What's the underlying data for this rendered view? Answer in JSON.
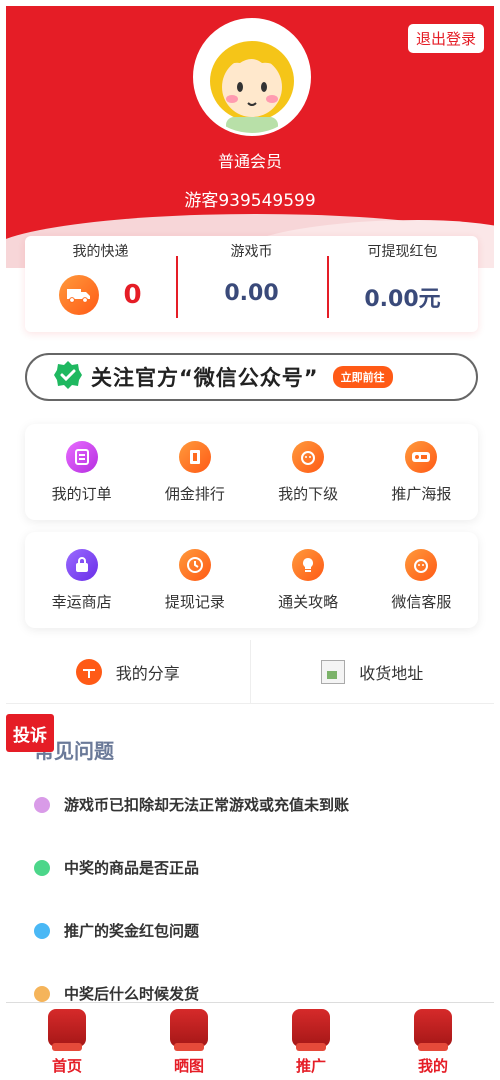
{
  "header": {
    "logout_label": "退出登录",
    "member_level": "普通会员",
    "username": "游客939549599",
    "brand_color": "#e51d26"
  },
  "stats": [
    {
      "label": "我的快递",
      "value": "0",
      "icon": "truck-icon"
    },
    {
      "label": "游戏币",
      "value": "0.00"
    },
    {
      "label": "可提现红包",
      "value": "0.00元"
    }
  ],
  "banner": {
    "text": "关注官方“微信公众号”",
    "button_label": "立即前往",
    "icon": "check-badge-icon"
  },
  "menu_row1": [
    {
      "label": "我的订单",
      "icon": "order-icon"
    },
    {
      "label": "佣金排行",
      "icon": "ranking-icon"
    },
    {
      "label": "我的下级",
      "icon": "subordinate-icon"
    },
    {
      "label": "推广海报",
      "icon": "poster-icon"
    }
  ],
  "menu_row2": [
    {
      "label": "幸运商店",
      "icon": "lock-bag-icon"
    },
    {
      "label": "提现记录",
      "icon": "clock-icon"
    },
    {
      "label": "通关攻略",
      "icon": "bulb-icon"
    },
    {
      "label": "微信客服",
      "icon": "service-icon"
    }
  ],
  "share_row": {
    "share_label": "我的分享",
    "address_label": "收货地址"
  },
  "complaint_label": "投诉",
  "faq": {
    "title": "常见问题",
    "items": [
      {
        "text": "游戏币已扣除却无法正常游戏或充值未到账",
        "color": "#d99be8"
      },
      {
        "text": "中奖的商品是否正品",
        "color": "#4cd68a"
      },
      {
        "text": "推广的奖金红包问题",
        "color": "#4ab8f5"
      },
      {
        "text": "中奖后什么时候发货",
        "color": "#f5b45a"
      }
    ]
  },
  "bottom_nav": [
    {
      "label": "首页",
      "icon": "home-icon"
    },
    {
      "label": "晒图",
      "icon": "photo-icon"
    },
    {
      "label": "推广",
      "icon": "promote-icon"
    },
    {
      "label": "我的",
      "icon": "profile-icon"
    }
  ]
}
